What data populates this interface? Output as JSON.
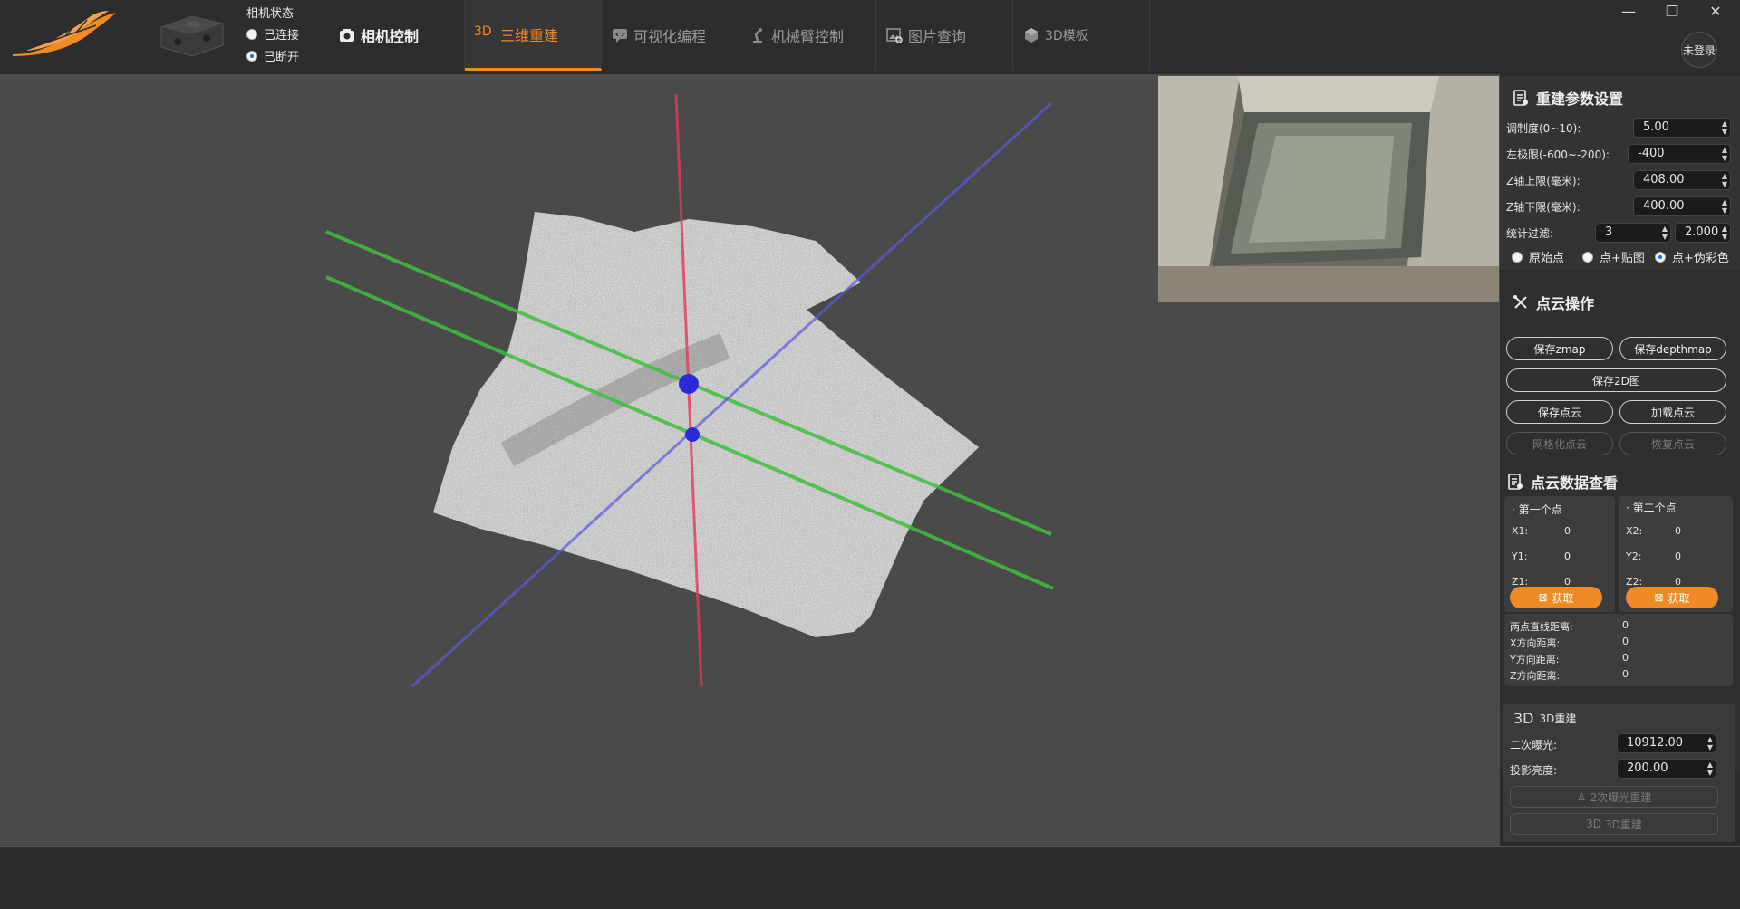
{
  "camera_status": {
    "title": "相机状态",
    "options": [
      {
        "label": "已连接",
        "selected": false
      },
      {
        "label": "已断开",
        "selected": true
      }
    ]
  },
  "nav": {
    "tabs": [
      {
        "label": "相机控制",
        "icon": "camera-icon"
      },
      {
        "label": "三维重建",
        "icon": "3d-reconstruct-icon",
        "active": true
      },
      {
        "label": "可视化编程",
        "icon": "chat-code-icon"
      },
      {
        "label": "机械臂控制",
        "icon": "robot-arm-icon"
      },
      {
        "label": "图片查询",
        "icon": "image-search-icon"
      },
      {
        "label": "3D模板",
        "icon": "cube-icon"
      }
    ],
    "tab_3d_glyph": "3D"
  },
  "window": {
    "minimize": "—",
    "restore": "❐",
    "close": "✕",
    "login_label": "未登录"
  },
  "colors": {
    "accent": "#f08a24",
    "axis_red": "#e23a5a",
    "axis_green": "#3fbf3f",
    "axis_blue": "#5a5adc",
    "viewport": "#4a4a4a"
  },
  "recon_params": {
    "title": "重建参数设置",
    "fields": [
      {
        "label": "调制度(0~10):",
        "value": "5.00"
      },
      {
        "label": "左极限(-600~-200):",
        "value": "-400"
      },
      {
        "label": "Z轴上限(毫米):",
        "value": "408.00"
      },
      {
        "label": "Z轴下限(毫米):",
        "value": "400.00"
      }
    ],
    "filter_label": "统计过滤:",
    "filter_count": "3",
    "filter_value": "2.000",
    "modes": [
      {
        "label": "原始点",
        "selected": false
      },
      {
        "label": "点+贴图",
        "selected": false
      },
      {
        "label": "点+伪彩色",
        "selected": true
      }
    ]
  },
  "cloud_ops": {
    "title": "点云操作",
    "buttons": {
      "save_zmap": "保存zmap",
      "save_depthmap": "保存depthmap",
      "save_2d": "保存2D图",
      "save_cloud": "保存点云",
      "load_cloud": "加载点云",
      "mesh_cloud": "网格化点云",
      "restore_cloud": "恢复点云"
    }
  },
  "cloud_view": {
    "title": "点云数据查看",
    "point1": {
      "title": "第一个点",
      "x_label": "X1:",
      "x": "0",
      "y_label": "Y1:",
      "y": "0",
      "z_label": "Z1:",
      "z": "0",
      "get": "获取"
    },
    "point2": {
      "title": "第二个点",
      "x_label": "X2:",
      "x": "0",
      "y_label": "Y2:",
      "y": "0",
      "z_label": "Z2:",
      "z": "0",
      "get": "获取"
    },
    "distances": [
      {
        "label": "两点直线距离:",
        "value": "0"
      },
      {
        "label": "X方向距离:",
        "value": "0"
      },
      {
        "label": "Y方向距离:",
        "value": "0"
      },
      {
        "label": "Z方向距离:",
        "value": "0"
      }
    ]
  },
  "recon3d": {
    "title": "3D重建",
    "glyph": "3D",
    "fields": [
      {
        "label": "二次曝光:",
        "value": "10912.00"
      },
      {
        "label": "投影亮度:",
        "value": "200.00"
      }
    ],
    "btn_double_exposure": "2次曝光重建",
    "btn_recon": "3D重建"
  }
}
